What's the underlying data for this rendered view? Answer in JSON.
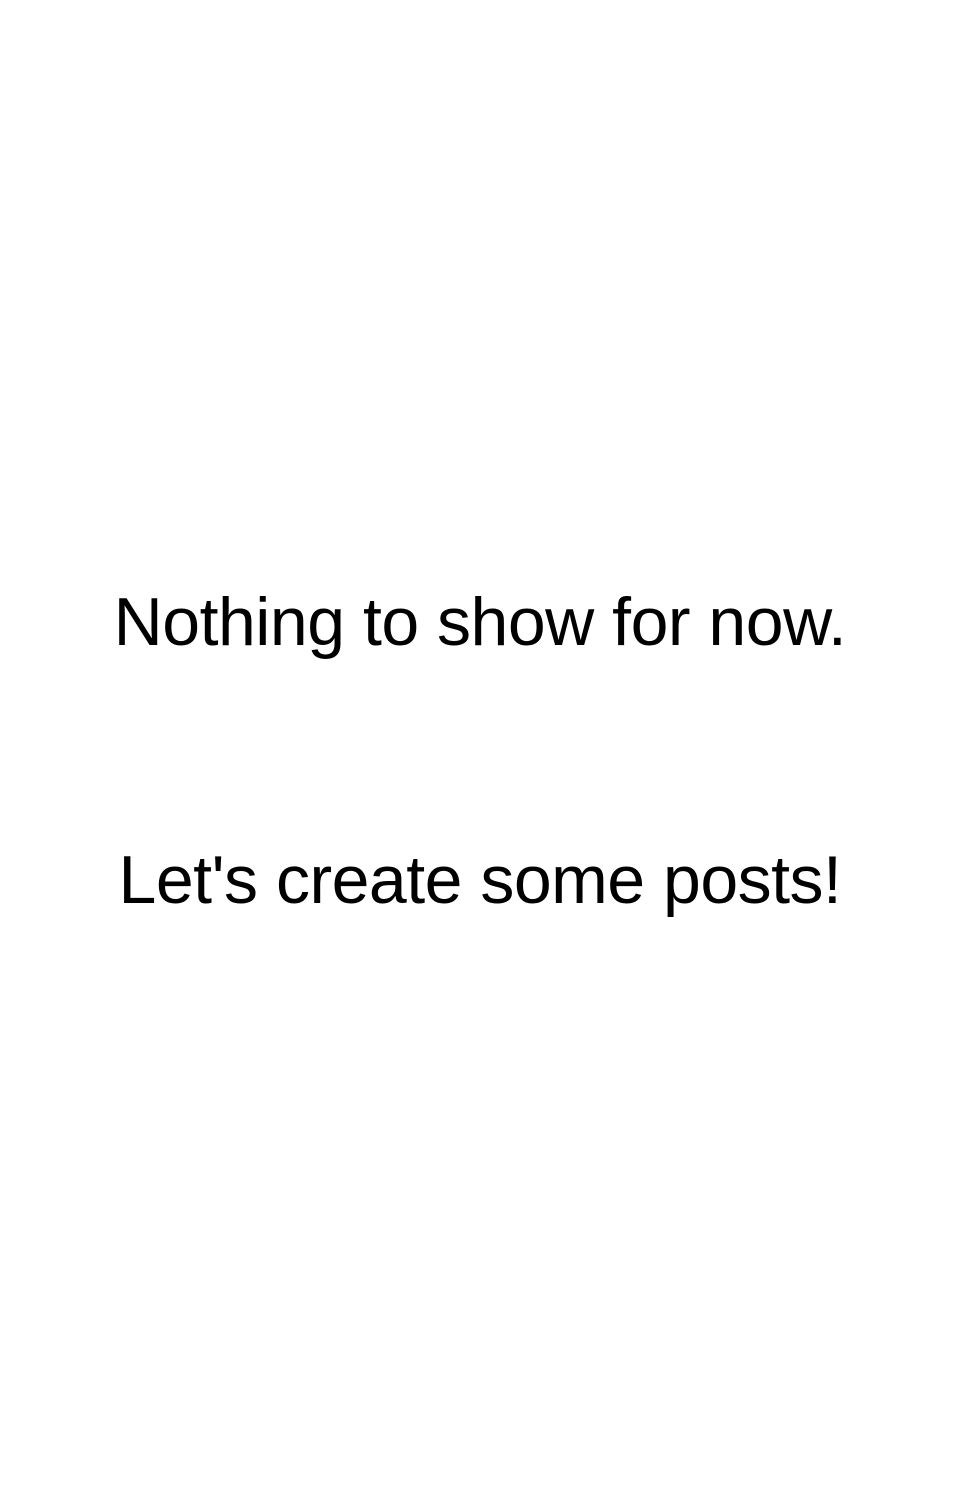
{
  "empty_state": {
    "message_primary": "Nothing to show for now.",
    "message_secondary": "Let's create some posts!"
  },
  "colors": {
    "background": "#ffffff",
    "text": "#000000"
  }
}
